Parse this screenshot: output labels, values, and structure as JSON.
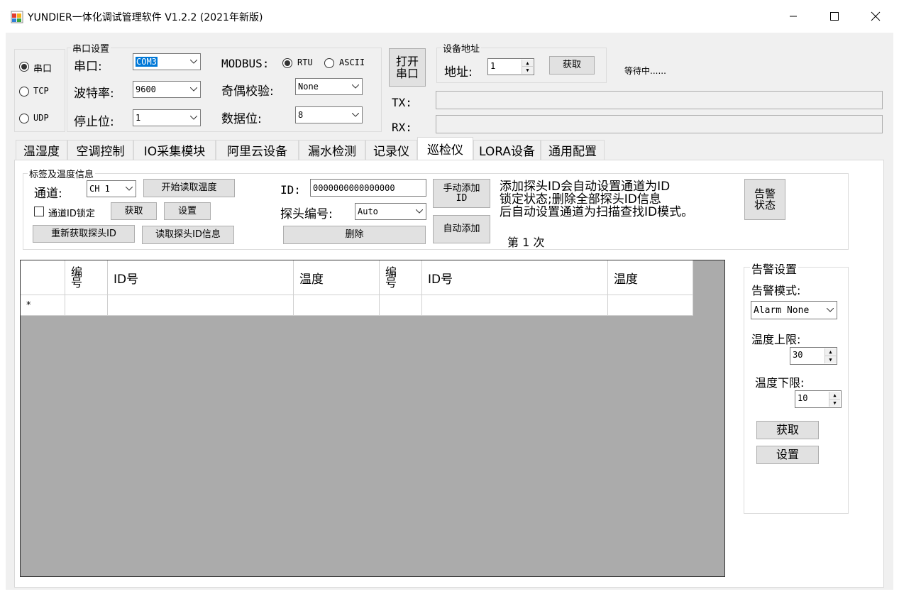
{
  "window": {
    "title": "YUNDIER一体化调试管理软件 V1.2.2  (2021年新版)"
  },
  "conn_type": {
    "serial": "串口",
    "tcp": "TCP",
    "udp": "UDP",
    "selected": "serial"
  },
  "serial_settings": {
    "group_title": "串口设置",
    "port_label": "串口:",
    "port_value": "COM3",
    "baud_label": "波特率:",
    "baud_value": "9600",
    "stopbits_label": "停止位:",
    "stopbits_value": "1",
    "modbus_label": "MODBUS:",
    "rtu_label": "RTU",
    "ascii_label": "ASCII",
    "modbus_selected": "RTU",
    "parity_label": "奇偶校验:",
    "parity_value": "None",
    "databits_label": "数据位:",
    "databits_value": "8"
  },
  "open_port_button": {
    "line1": "打开",
    "line2": "串口"
  },
  "device_address": {
    "group_title": "设备地址",
    "label": "地址:",
    "value": "1",
    "get_button": "获取"
  },
  "status_text": "等待中......",
  "tx_label": "TX:",
  "rx_label": "RX:",
  "tx_value": "",
  "rx_value": "",
  "tabs": [
    "温湿度",
    "空调控制",
    "IO采集模块",
    "阿里云设备",
    "漏水检测",
    "记录仪",
    "巡检仪",
    "LORA设备",
    "通用配置"
  ],
  "active_tab": "巡检仪",
  "tag_panel": {
    "group_title": "标签及温度信息",
    "channel_label": "通道:",
    "channel_value": "CH 1",
    "start_read_button": "开始读取温度",
    "lock_checkbox_label": "通道ID锁定",
    "get_button": "获取",
    "set_button": "设置",
    "reacquire_button": "重新获取探头ID",
    "read_probe_info_button": "读取探头ID信息",
    "id_label": "ID:",
    "id_value": "0000000000000000",
    "probe_no_label": "探头编号:",
    "probe_no_value": "Auto",
    "delete_button": "删除",
    "manual_add_button_l1": "手动添加",
    "manual_add_button_l2": "ID",
    "auto_add_button": "自动添加",
    "hint_line1": "添加探头ID会自动设置通道为ID",
    "hint_line2": "锁定状态;删除全部探头ID信息",
    "hint_line3": "后自动设置通道为扫描查找ID模式。",
    "count_text": "第 1 次",
    "alarm_status_l1": "告警",
    "alarm_status_l2": "状态"
  },
  "table": {
    "columns": [
      "编号",
      "ID号",
      "温度",
      "编号",
      "ID号",
      "温度"
    ],
    "new_row_marker": "*"
  },
  "alarm_settings": {
    "group_title": "告警设置",
    "mode_label": "告警模式:",
    "mode_value": "Alarm None",
    "upper_label": "温度上限:",
    "upper_value": "30",
    "lower_label": "温度下限:",
    "lower_value": "10",
    "get_button": "获取",
    "set_button": "设置"
  },
  "colors": {
    "grid_bg": "#ababab",
    "client_bg": "#f0f0f0",
    "selection": "#0078d7"
  }
}
